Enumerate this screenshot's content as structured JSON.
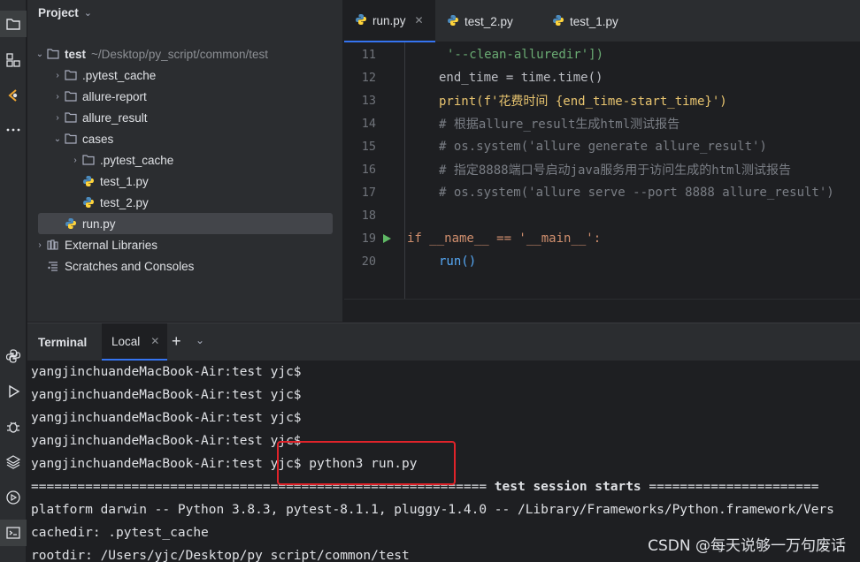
{
  "project": {
    "title": "Project",
    "tree": [
      {
        "label": "test",
        "path": "~/Desktop/py_script/common/test",
        "kind": "folder",
        "expanded": true,
        "level": 0
      },
      {
        "label": ".pytest_cache",
        "kind": "folder",
        "expanded": false,
        "level": 1
      },
      {
        "label": "allure-report",
        "kind": "folder",
        "expanded": false,
        "level": 1
      },
      {
        "label": "allure_result",
        "kind": "folder",
        "expanded": false,
        "level": 1
      },
      {
        "label": "cases",
        "kind": "folder",
        "expanded": true,
        "level": 1
      },
      {
        "label": ".pytest_cache",
        "kind": "folder",
        "expanded": false,
        "level": 2
      },
      {
        "label": "test_1.py",
        "kind": "python",
        "level": 2
      },
      {
        "label": "test_2.py",
        "kind": "python",
        "level": 2
      },
      {
        "label": "run.py",
        "kind": "python",
        "level": 1,
        "selected": true
      },
      {
        "label": "External Libraries",
        "kind": "library",
        "level": 0
      },
      {
        "label": "Scratches and Consoles",
        "kind": "scratch",
        "level": 0
      }
    ]
  },
  "editor": {
    "tabs": [
      {
        "label": "run.py",
        "active": true,
        "closable": true
      },
      {
        "label": "test_2.py",
        "active": false
      },
      {
        "label": "test_1.py",
        "active": false
      }
    ],
    "lines": [
      {
        "n": "11",
        "text": "'--clean-alluredir'])"
      },
      {
        "n": "12",
        "text": "end_time = time.time()"
      },
      {
        "n": "13",
        "text": "print(f'花费时间 {end_time-start_time}')"
      },
      {
        "n": "14",
        "text": "# 根据allure_result生成html测试报告"
      },
      {
        "n": "15",
        "text": "# os.system('allure generate allure_result')"
      },
      {
        "n": "16",
        "text": "# 指定8888端口号启动java服务用于访问生成的html测试报告"
      },
      {
        "n": "17",
        "text": "# os.system('allure serve --port 8888 allure_result')"
      },
      {
        "n": "18",
        "text": ""
      },
      {
        "n": "19",
        "text": "if __name__ == '__main__':"
      },
      {
        "n": "20",
        "text": "run()"
      }
    ]
  },
  "terminal": {
    "title": "Terminal",
    "tab": "Local",
    "prompt": "yangjinchuandeMacBook-Air:test yjc$",
    "command": " python3 run.py",
    "session_rule_left": "===========================================================",
    "session_text": " test session starts ",
    "session_rule_right": "======================",
    "platform_line": "platform darwin -- Python 3.8.3, pytest-8.1.1, pluggy-1.4.0 -- /Library/Frameworks/Python.framework/Vers",
    "cachedir_line": "cachedir: .pytest_cache",
    "rootdir_line": "rootdir: /Users/yjc/Desktop/py_script/common/test"
  },
  "watermark": "CSDN @每天说够一万句废话",
  "colors": {
    "accent": "#3574f0",
    "highlight_box": "#e0232a",
    "run_icon": "#5fb865"
  }
}
